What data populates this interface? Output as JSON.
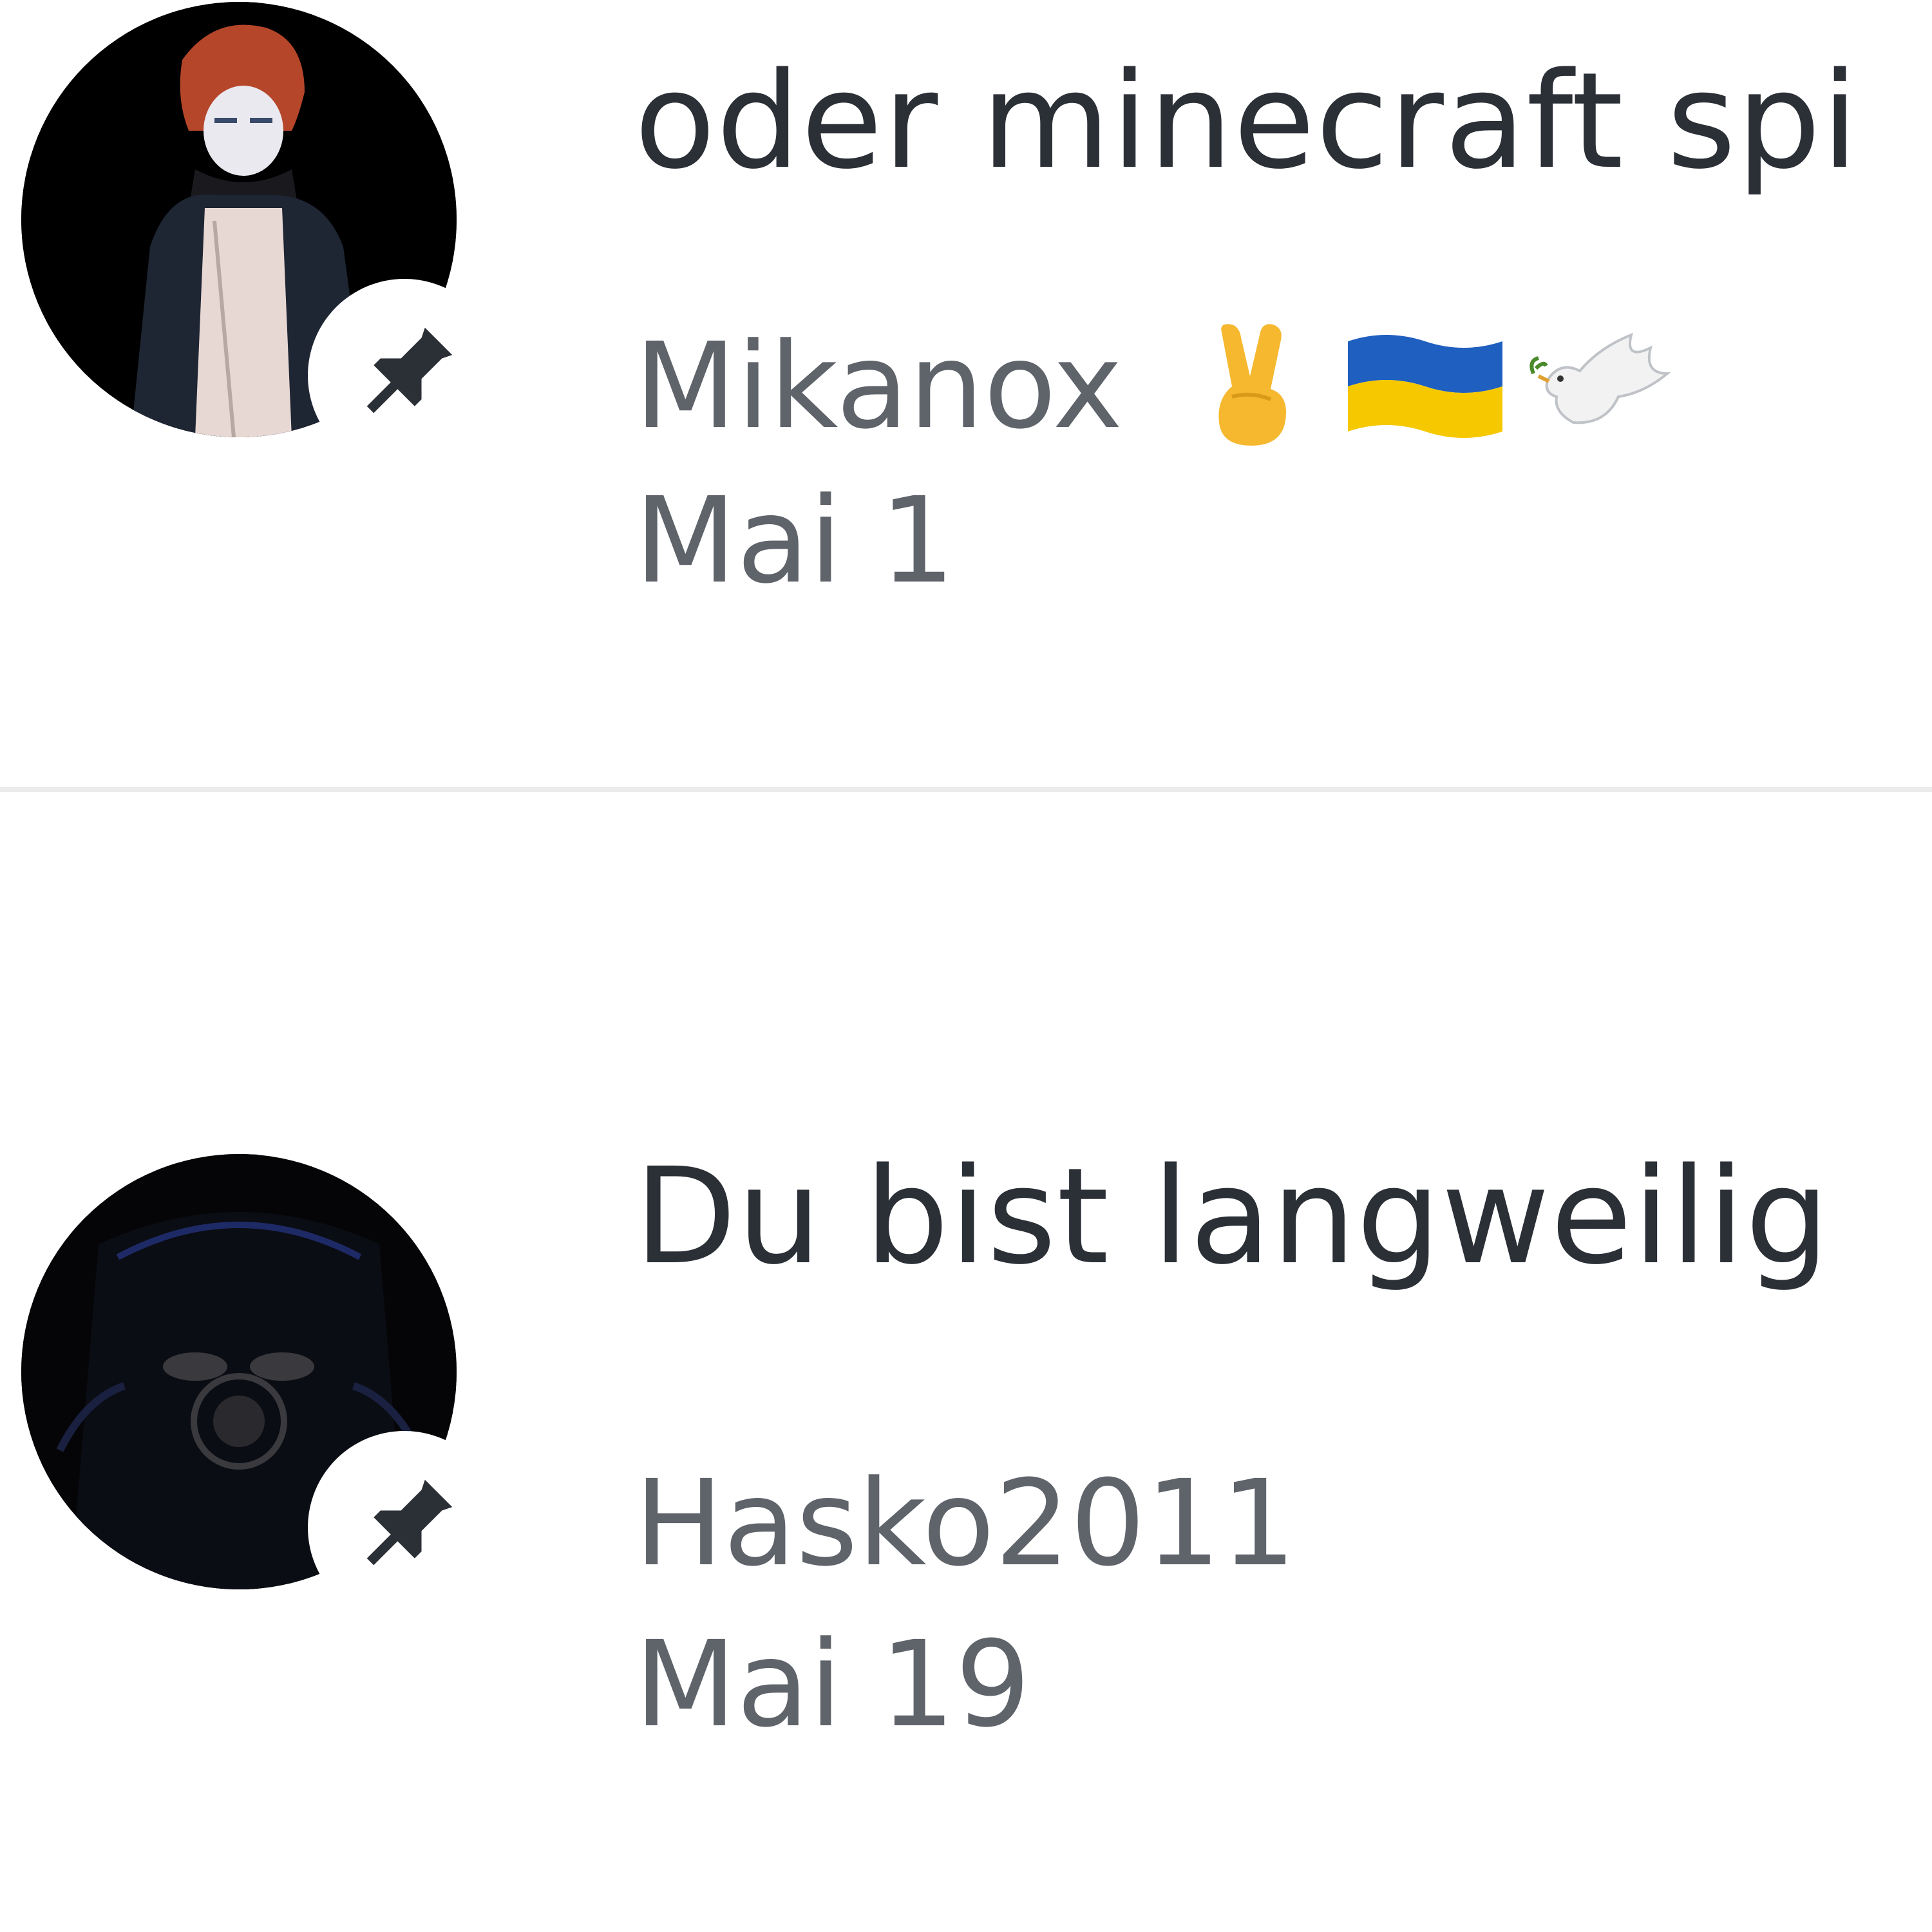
{
  "comments": [
    {
      "message": "oder minecraft spi",
      "author": "Mikanox",
      "author_emojis": [
        "victory-hand-emoji",
        "ukraine-flag-emoji",
        "dove-emoji"
      ],
      "date": "Mai 1",
      "pinned": true,
      "colors": {
        "flag_blue": "#1f5fbf",
        "flag_yellow": "#f6c800",
        "hand": "#f5b82e"
      }
    },
    {
      "message": "Du bist langweilig",
      "author": "Hasko2011",
      "date": "Mai 19",
      "pinned": true
    }
  ],
  "colors": {
    "message_text": "#2b2f36",
    "meta_text": "#5f636a",
    "divider": "#ebebeb",
    "pin_icon": "#2b2f36"
  }
}
